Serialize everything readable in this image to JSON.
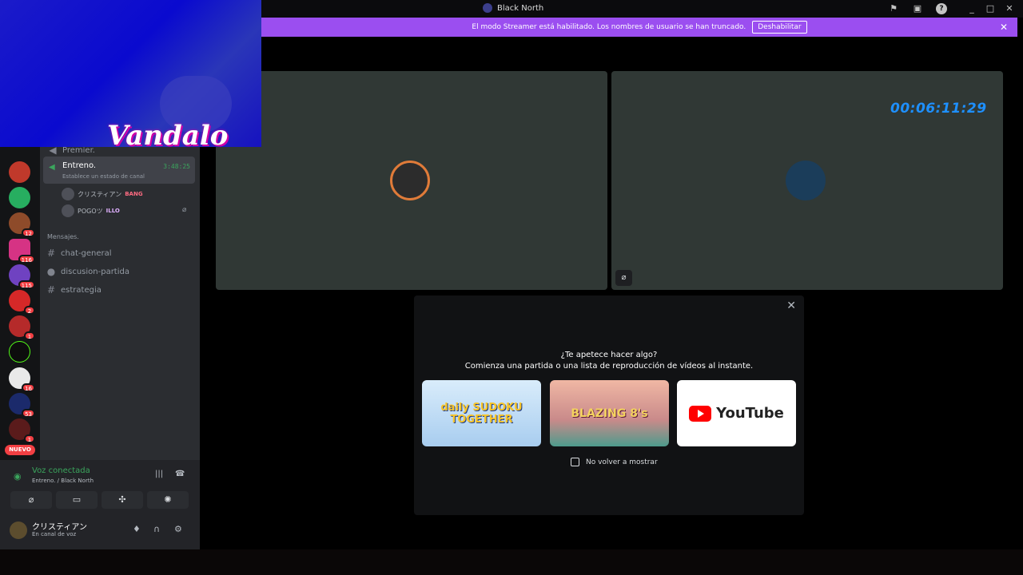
{
  "window": {
    "title": "Black North",
    "controls": [
      "_",
      "□",
      "✕"
    ]
  },
  "banner": {
    "text": "El modo Streamer está habilitado. Los nombres de usuario se han truncado.",
    "button_label": "Deshabilitar"
  },
  "webcam": {
    "brand_text": "Vandalo"
  },
  "guild_badges": [
    "12",
    "116",
    "115",
    "2",
    "1",
    "16",
    "53",
    "1"
  ],
  "guild_new_label": "NUEVO",
  "channels": {
    "premier_label": "Premier.",
    "active_voice": {
      "name": "Entreno.",
      "status_hint": "Establece un estado de canal",
      "timer": "3:48:25"
    },
    "voice_users": [
      {
        "name": "クリスティアン",
        "tag": "BANG"
      },
      {
        "name": "POGOツ",
        "tag": "ILLO"
      }
    ],
    "section_header": "Mensajes.",
    "text_channels": [
      "chat-general",
      "discusion-partida",
      "estrategia"
    ]
  },
  "voice_panel": {
    "status": "Voz conectada",
    "location": "Entreno. / Black North"
  },
  "user": {
    "name": "クリスティアン",
    "status": "En canal de voz"
  },
  "stream": {
    "timer": "00:06:11:29"
  },
  "activity_modal": {
    "question": "¿Te apetece hacer algo?",
    "subtitle": "Comienza una partida o una lista de reproducción de vídeos al instante.",
    "cards": [
      {
        "title": "daily SUDOKU TOGETHER",
        "color": "#cfe3f6"
      },
      {
        "title": "BLAZING 8's",
        "color": "#e6a3a0"
      },
      {
        "title": "YouTube",
        "color": "#ffffff"
      }
    ],
    "dont_show_label": "No volver a mostrar"
  }
}
